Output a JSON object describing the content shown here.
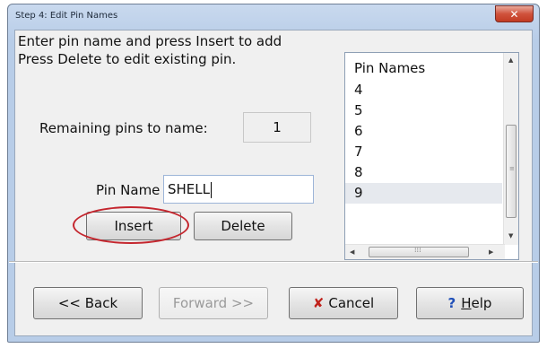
{
  "window": {
    "title": "Step 4: Edit Pin Names",
    "close_glyph": "✕"
  },
  "instructions": {
    "line1": "Enter pin name and press Insert to add",
    "line2": "Press Delete to edit existing pin."
  },
  "remaining": {
    "label": "Remaining pins to name:",
    "value": "1"
  },
  "pin_name": {
    "label": "Pin Name",
    "value": "SHELL"
  },
  "buttons": {
    "insert": "Insert",
    "delete": "Delete",
    "back": "<< Back",
    "forward": ">> ",
    "forward_label": "Forward >>",
    "cancel_prefix": "C",
    "cancel_rest": "ancel",
    "help_underlined": "H",
    "help_rest": "elp"
  },
  "pin_list": {
    "header": "Pin Names",
    "items": [
      "4",
      "5",
      "6",
      "7",
      "8",
      "9"
    ],
    "selected": "9"
  },
  "colors": {
    "highlight_oval": "#c4262e",
    "cancel_icon": "#c0221c",
    "help_icon": "#1f4fb8"
  },
  "icons": {
    "cancel": "x-mark-icon",
    "help": "question-mark-icon"
  }
}
